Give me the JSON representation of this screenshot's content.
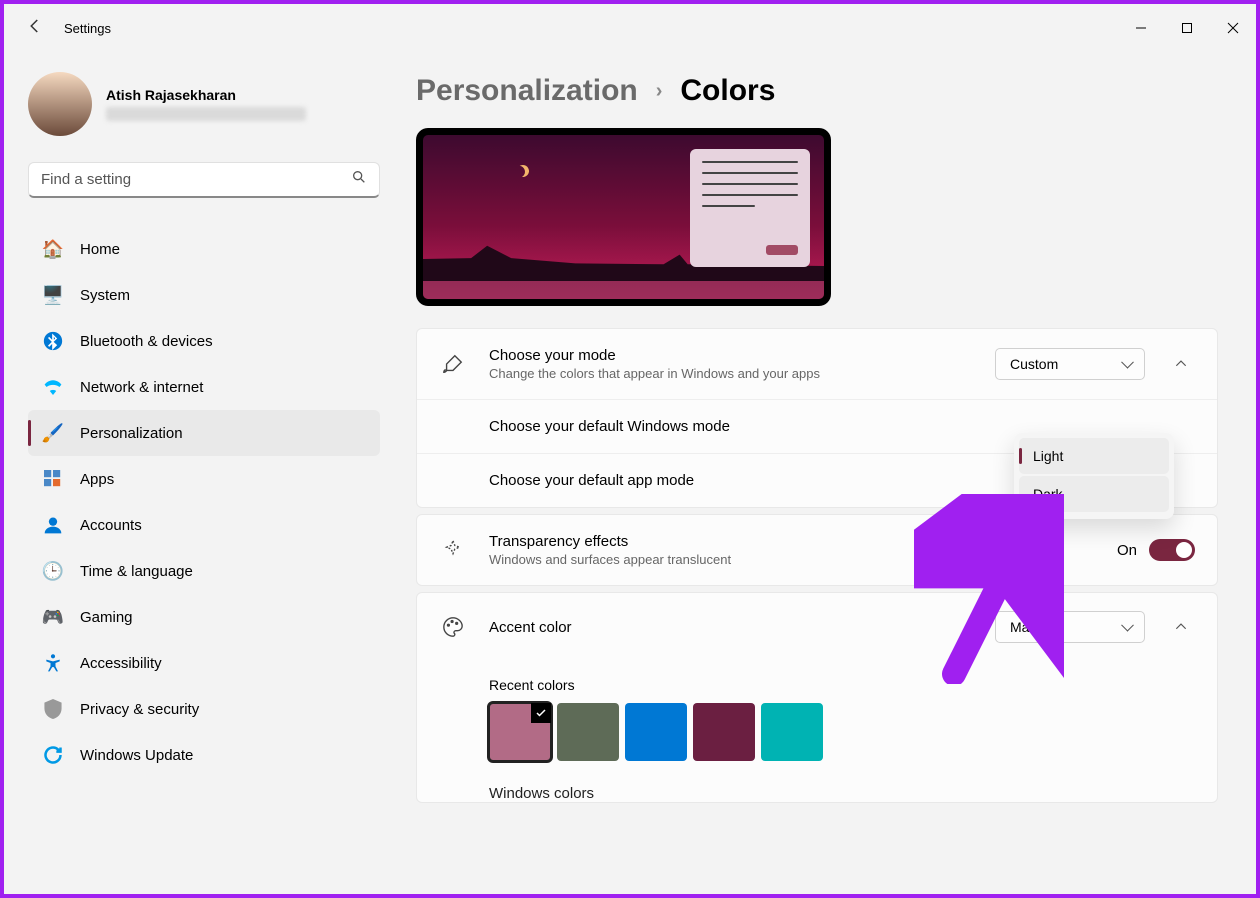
{
  "window": {
    "title": "Settings"
  },
  "user": {
    "name": "Atish Rajasekharan"
  },
  "search": {
    "placeholder": "Find a setting"
  },
  "sidebar": {
    "items": [
      {
        "label": "Home",
        "icon": "🏠"
      },
      {
        "label": "System",
        "icon": "🖥️"
      },
      {
        "label": "Bluetooth & devices",
        "icon": "ᚼ",
        "iconColor": "#0078d4"
      },
      {
        "label": "Network & internet",
        "icon": "📶",
        "iconColor": "#00b7ff"
      },
      {
        "label": "Personalization",
        "icon": "🖌️",
        "active": true
      },
      {
        "label": "Apps",
        "icon": "▦"
      },
      {
        "label": "Accounts",
        "icon": "👤",
        "iconColor": "#0078d4"
      },
      {
        "label": "Time & language",
        "icon": "🕒"
      },
      {
        "label": "Gaming",
        "icon": "🎮"
      },
      {
        "label": "Accessibility",
        "icon": "⇡",
        "iconColor": "#0078d4"
      },
      {
        "label": "Privacy & security",
        "icon": "🛡️"
      },
      {
        "label": "Windows Update",
        "icon": "🔄",
        "iconColor": "#0099e5"
      }
    ]
  },
  "breadcrumb": {
    "parent": "Personalization",
    "current": "Colors"
  },
  "mode": {
    "title": "Choose your mode",
    "sub": "Change the colors that appear in Windows and your apps",
    "value": "Custom",
    "win_mode_label": "Choose your default Windows mode",
    "app_mode_label": "Choose your default app mode",
    "menu": {
      "opt1": "Light",
      "opt2": "Dark"
    }
  },
  "transparency": {
    "title": "Transparency effects",
    "sub": "Windows and surfaces appear translucent",
    "state": "On"
  },
  "accent": {
    "title": "Accent color",
    "value": "Manual",
    "recent_label": "Recent colors",
    "colors": [
      "#b26b86",
      "#5e6b57",
      "#0078d4",
      "#6b1f41",
      "#00b3b3"
    ],
    "next_label": "Windows colors"
  }
}
